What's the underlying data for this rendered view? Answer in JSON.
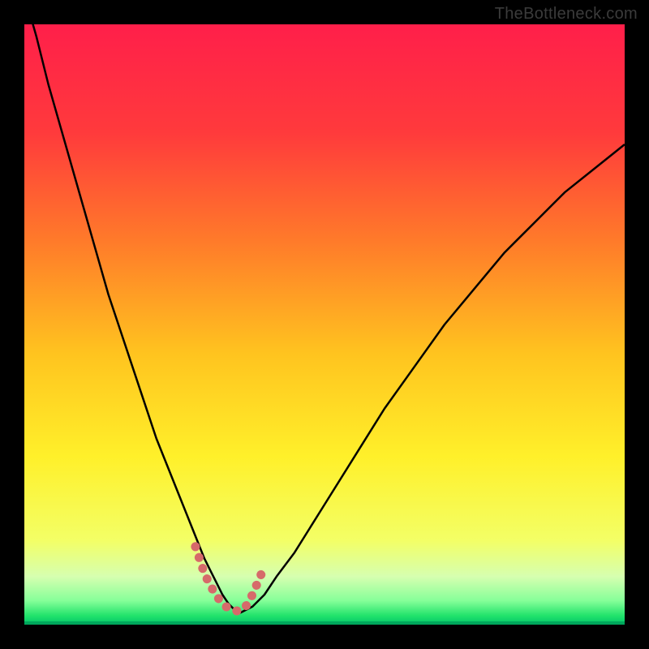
{
  "watermark": "TheBottleneck.com",
  "chart_data": {
    "type": "line",
    "title": "",
    "xlabel": "",
    "ylabel": "",
    "xlim": [
      0,
      100
    ],
    "ylim": [
      0,
      100
    ],
    "gradient_stops": [
      {
        "offset": 0.0,
        "color": "#ff1f4a"
      },
      {
        "offset": 0.18,
        "color": "#ff3a3c"
      },
      {
        "offset": 0.36,
        "color": "#ff7a2a"
      },
      {
        "offset": 0.55,
        "color": "#ffc41f"
      },
      {
        "offset": 0.72,
        "color": "#fff02a"
      },
      {
        "offset": 0.86,
        "color": "#f3ff66"
      },
      {
        "offset": 0.92,
        "color": "#d6ffb0"
      },
      {
        "offset": 0.96,
        "color": "#86ff99"
      },
      {
        "offset": 0.985,
        "color": "#22e36b"
      },
      {
        "offset": 1.0,
        "color": "#00c36a"
      }
    ],
    "series": [
      {
        "name": "bottleneck-curve",
        "color": "#000000",
        "width": 2.5,
        "x": [
          0,
          2,
          4,
          6,
          8,
          10,
          12,
          14,
          16,
          18,
          20,
          22,
          24,
          26,
          28,
          30,
          31,
          32,
          33,
          34,
          35,
          36,
          38,
          40,
          42,
          45,
          50,
          55,
          60,
          65,
          70,
          75,
          80,
          85,
          90,
          95,
          100
        ],
        "values": [
          105,
          98,
          90,
          83,
          76,
          69,
          62,
          55,
          49,
          43,
          37,
          31,
          26,
          21,
          16,
          11,
          9,
          7,
          5,
          3.5,
          2.5,
          2,
          3,
          5,
          8,
          12,
          20,
          28,
          36,
          43,
          50,
          56,
          62,
          67,
          72,
          76,
          80
        ]
      },
      {
        "name": "highlight-valley",
        "color": "#d66a6a",
        "width": 11,
        "linecap": "round",
        "x": [
          28.5,
          30,
          31,
          32,
          33,
          34,
          35,
          36,
          37,
          38,
          39.5
        ],
        "values": [
          13,
          8.5,
          6.5,
          4.8,
          3.5,
          2.7,
          2.3,
          2.3,
          3.2,
          5.0,
          8.5
        ]
      }
    ]
  }
}
